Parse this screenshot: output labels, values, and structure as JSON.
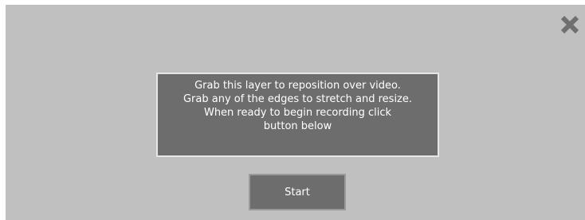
{
  "overlay": {
    "close_icon": "close-icon",
    "instructions": {
      "lines": [
        "Grab this layer to reposition over video.",
        "Grab any of the edges to stretch and resize.",
        "When ready to begin recording click",
        "button below"
      ]
    },
    "start_label": "Start"
  },
  "colors": {
    "overlay_bg": "#c0c0c0",
    "panel_bg": "#6d6d6d",
    "close_icon": "#707070",
    "text": "#ffffff"
  }
}
